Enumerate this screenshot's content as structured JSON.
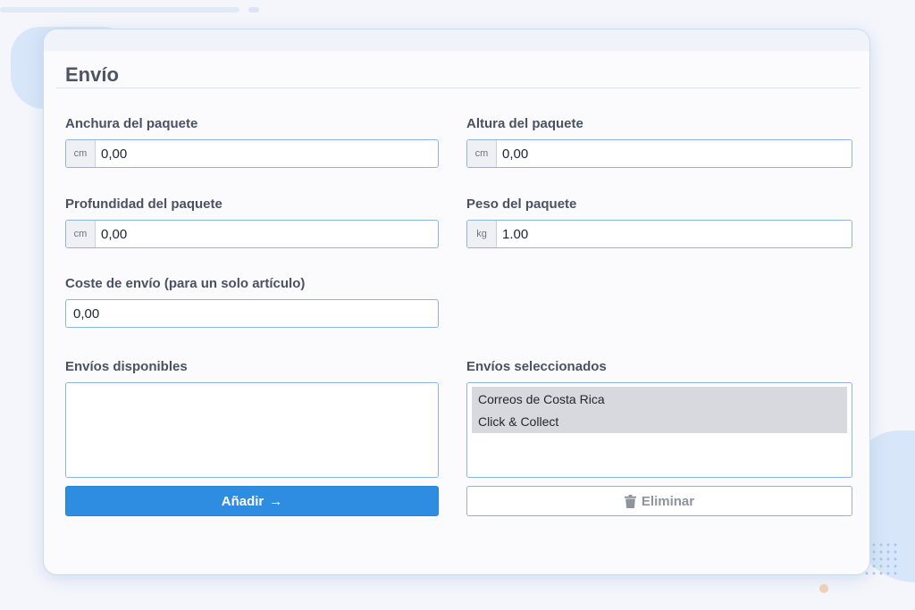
{
  "panel": {
    "title": "Envío"
  },
  "fields": {
    "width": {
      "label": "Anchura del paquete",
      "unit": "cm",
      "value": "0,00"
    },
    "height": {
      "label": "Altura del paquete",
      "unit": "cm",
      "value": "0,00"
    },
    "depth": {
      "label": "Profundidad del paquete",
      "unit": "cm",
      "value": "0,00"
    },
    "weight": {
      "label": "Peso del paquete",
      "unit": "kg",
      "value": "1.00"
    },
    "shipping_cost": {
      "label": "Coste de envío (para un solo artículo)",
      "value": "0,00"
    }
  },
  "available": {
    "label": "Envíos disponibles",
    "items": []
  },
  "selected": {
    "label": "Envíos seleccionados",
    "items": [
      "Correos de Costa Rica",
      "Click & Collect"
    ]
  },
  "buttons": {
    "add_label": "Añadir",
    "add_icon": "arrow-right-icon",
    "remove_label": "Eliminar",
    "remove_icon": "trash-icon"
  },
  "colors": {
    "primary": "#2e8de0",
    "input_border": "#8eb4e3",
    "selected_item_bg": "#d7d9de"
  }
}
